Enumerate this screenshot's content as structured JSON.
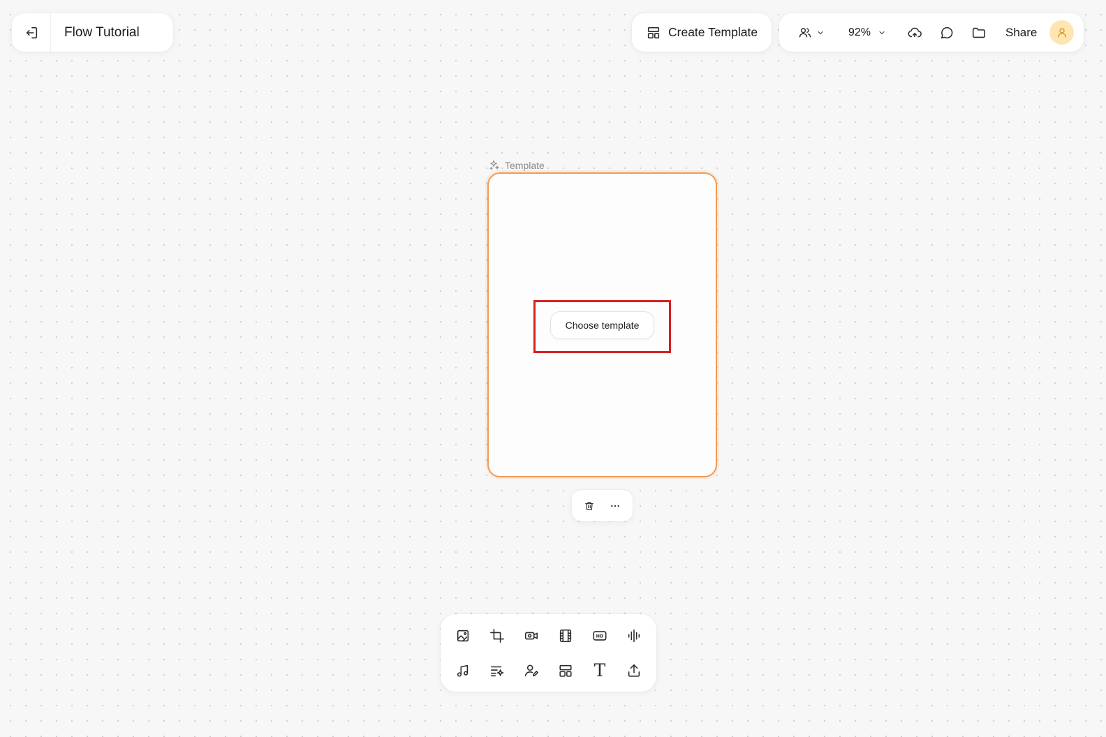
{
  "header": {
    "back_icon": "exit-icon",
    "project_title": "Flow Tutorial",
    "create_template_label": "Create Template",
    "zoom_level": "92%",
    "share_label": "Share"
  },
  "canvas": {
    "frame_label": "Template",
    "choose_template_label": "Choose template",
    "frame_accent": "#f29a52",
    "highlight_color": "#d6201f"
  },
  "bottom_toolbar": {
    "tools": [
      "image-edit-icon",
      "crop-icon",
      "video-camera-icon",
      "film-icon",
      "hd-icon",
      "audio-wave-icon",
      "music-note-icon",
      "text-list-sparkle-icon",
      "user-edit-icon",
      "layout-icon",
      "text-icon",
      "upload-icon"
    ]
  },
  "colors": {
    "avatar_bg": "#fde6b3",
    "avatar_fg": "#e0901a"
  }
}
